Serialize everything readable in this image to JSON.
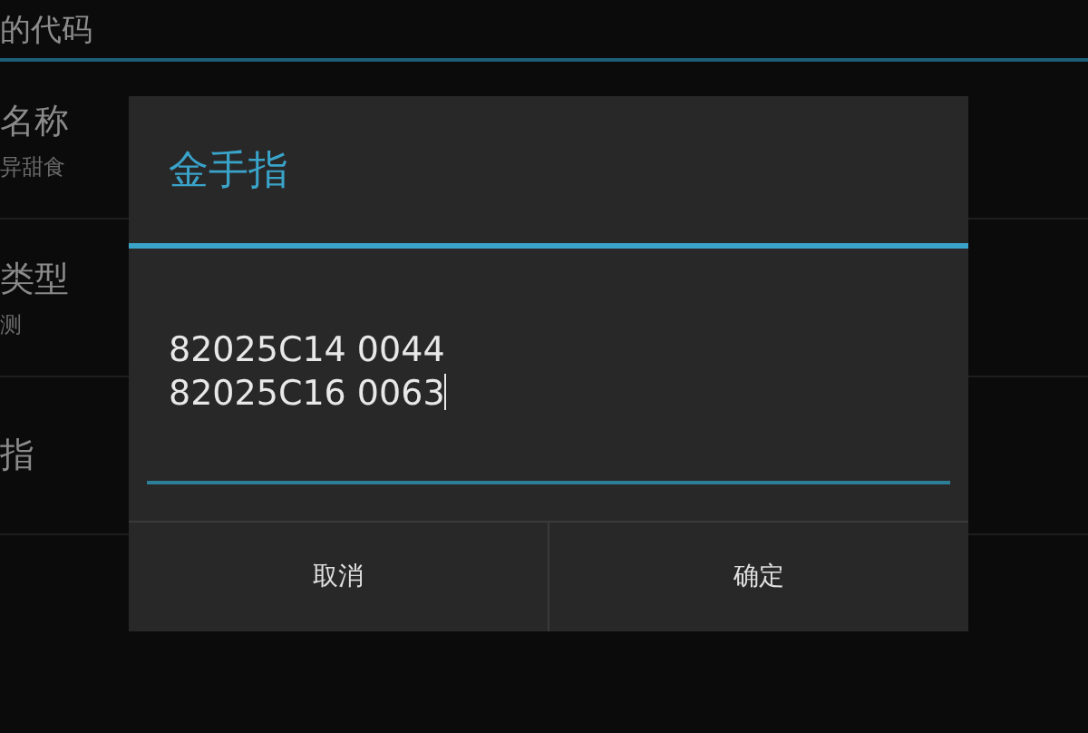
{
  "background": {
    "header": "的代码",
    "rows": [
      {
        "label": "名称",
        "value": "异甜食"
      },
      {
        "label": "类型",
        "value": "测"
      },
      {
        "label": "指",
        "value": ""
      }
    ]
  },
  "dialog": {
    "title": "金手指",
    "field": {
      "lines": [
        "82025C14 0044",
        "82025C16 0063"
      ],
      "focused": true
    },
    "buttons": [
      "取消",
      "确定"
    ]
  }
}
